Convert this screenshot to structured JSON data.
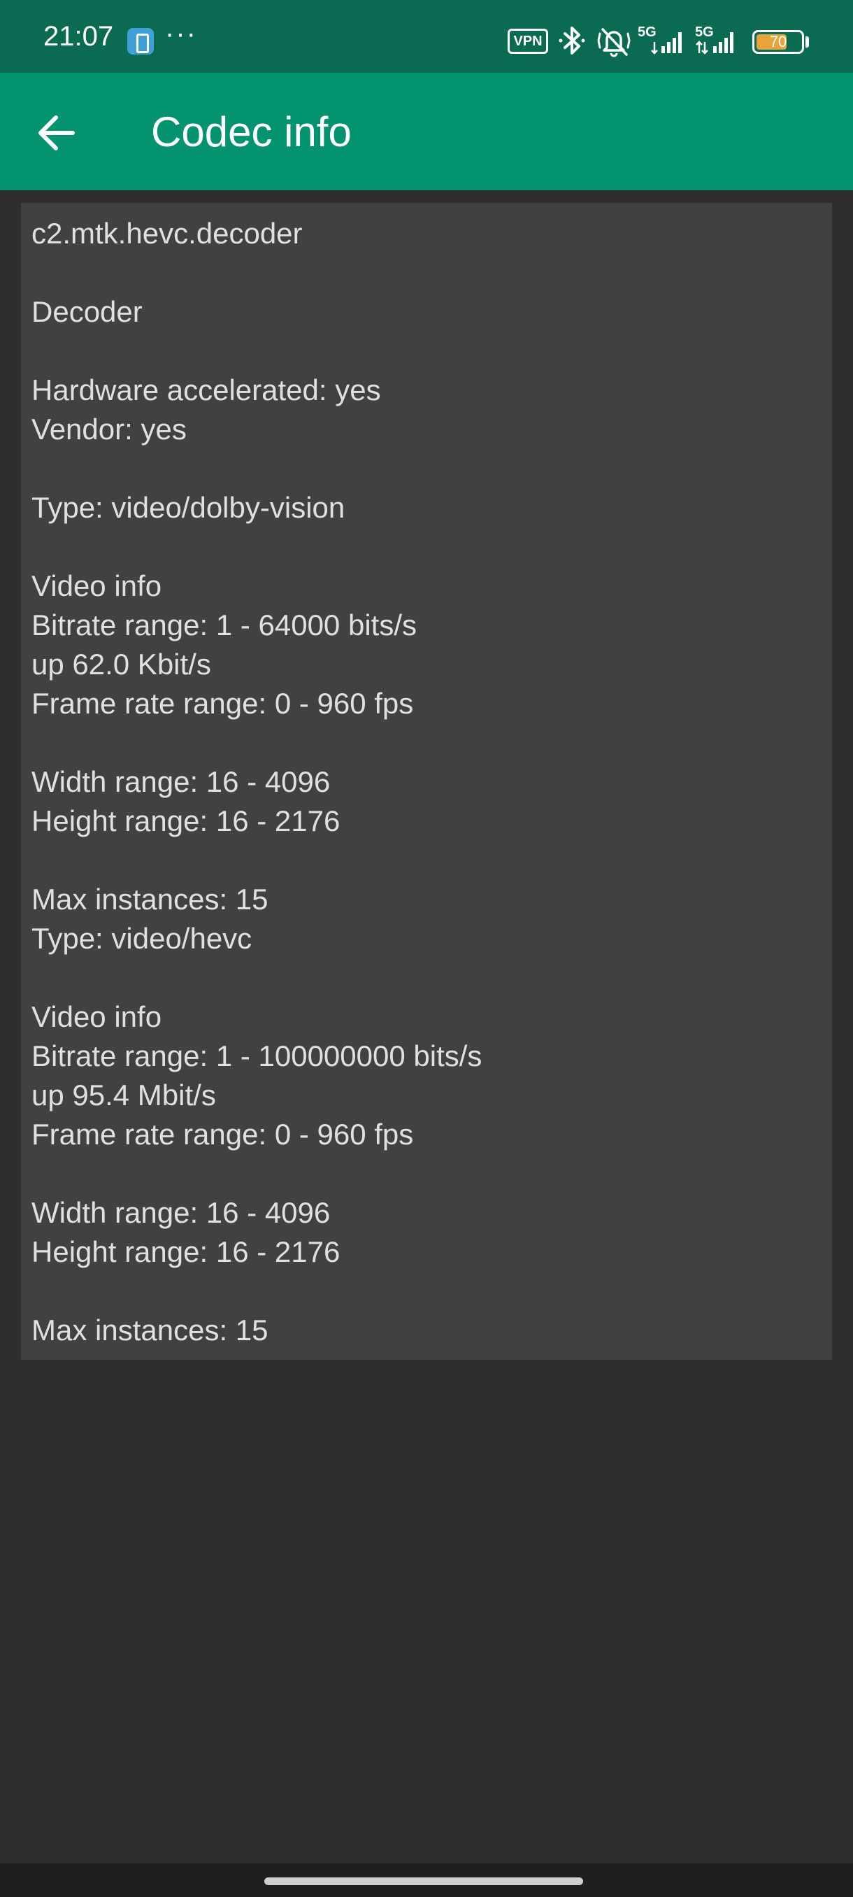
{
  "status_bar": {
    "time": "21:07",
    "more": "···",
    "vpn_label": "VPN",
    "network_type_1": "5G",
    "network_type_2": "5G",
    "battery_level": "70",
    "battery_fraction": 0.7,
    "icons": [
      "app-notification-icon",
      "vpn-icon",
      "bluetooth-icon",
      "vibrate-mute-icon",
      "signal-5g-icon",
      "signal-5g-icon",
      "battery-icon"
    ]
  },
  "app_bar": {
    "back_icon": "arrow-left-icon",
    "title": "Codec info",
    "background": "#04936f"
  },
  "codec_info": {
    "lines": [
      "c2.mtk.hevc.decoder",
      "",
      "Decoder",
      "",
      "Hardware accelerated: yes",
      "Vendor: yes",
      "",
      "Type: video/dolby-vision",
      "",
      "Video info",
      "Bitrate range: 1 - 64000 bits/s",
      "up 62.0 Kbit/s",
      "Frame rate range: 0 - 960 fps",
      "",
      "Width range: 16 - 4096",
      "Height range: 16 - 2176",
      "",
      "Max instances: 15",
      "Type: video/hevc",
      "",
      "Video info",
      "Bitrate range: 1 - 100000000 bits/s",
      "up 95.4 Mbit/s",
      "Frame rate range: 0 - 960 fps",
      "",
      "Width range: 16 - 4096",
      "Height range: 16 - 2176",
      "",
      "Max instances: 15"
    ]
  },
  "colors": {
    "status_bar": "#0a6b52",
    "app_bar": "#04936f",
    "card": "#414141",
    "background": "#2e2e2e",
    "battery": "#e8a43a"
  }
}
